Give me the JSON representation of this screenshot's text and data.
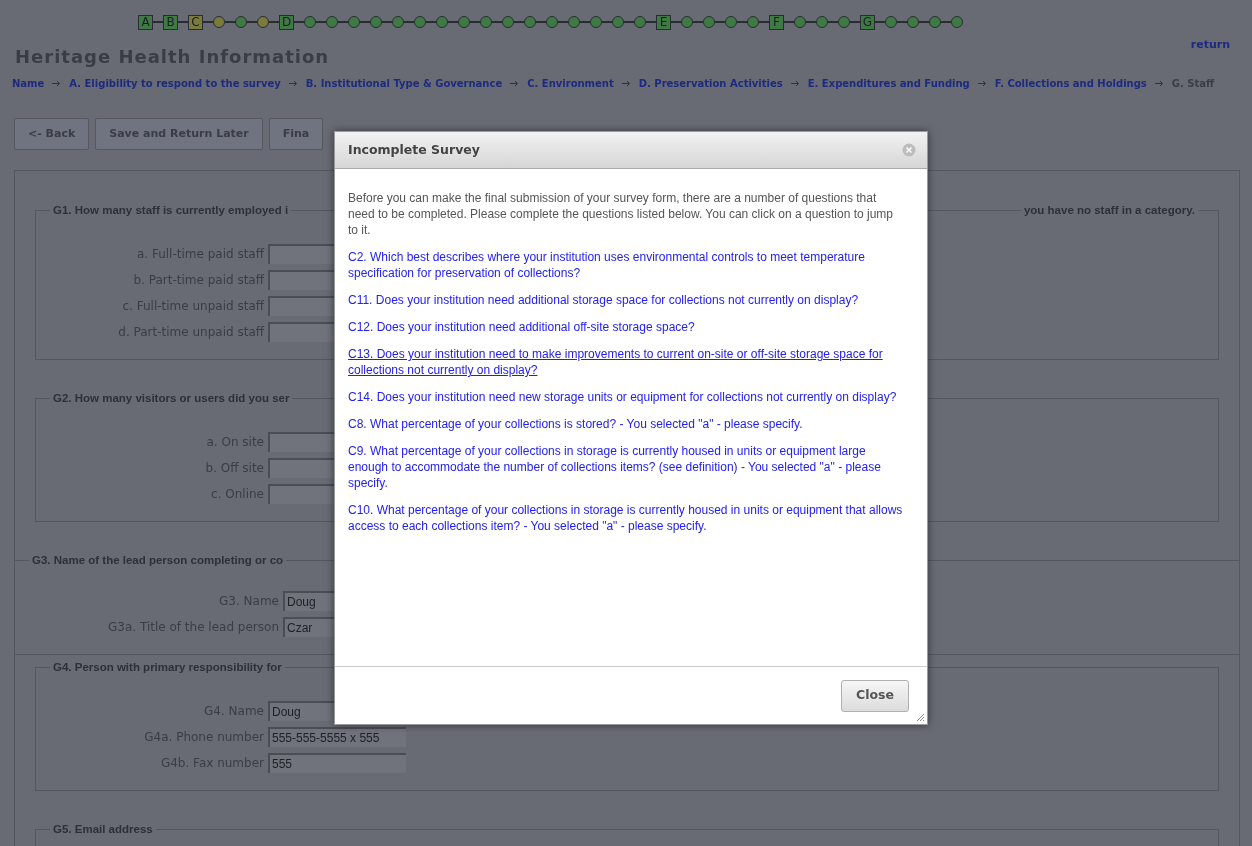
{
  "progress": [
    {
      "label": "A",
      "color": "#3f7a45"
    },
    {
      "label": "B",
      "color": "#3f7a45"
    },
    {
      "label": "C",
      "color": "#7a7a3c"
    },
    {
      "color": "#7a7a3c"
    },
    {
      "color": "#3f7a45"
    },
    {
      "color": "#7a7a3c"
    },
    {
      "label": "D",
      "color": "#3f7a45"
    },
    {
      "color": "#3f7a45"
    },
    {
      "color": "#3f7a45"
    },
    {
      "color": "#3f7a45"
    },
    {
      "color": "#3f7a45"
    },
    {
      "color": "#3f7a45"
    },
    {
      "color": "#3f7a45"
    },
    {
      "color": "#3f7a45"
    },
    {
      "color": "#3f7a45"
    },
    {
      "color": "#3f7a45"
    },
    {
      "color": "#3f7a45"
    },
    {
      "color": "#3f7a45"
    },
    {
      "color": "#3f7a45"
    },
    {
      "color": "#3f7a45"
    },
    {
      "color": "#3f7a45"
    },
    {
      "color": "#3f7a45"
    },
    {
      "color": "#3f7a45"
    },
    {
      "label": "E",
      "color": "#3f7a45"
    },
    {
      "color": "#3f7a45"
    },
    {
      "color": "#3f7a45"
    },
    {
      "color": "#3f7a45"
    },
    {
      "color": "#3f7a45"
    },
    {
      "label": "F",
      "color": "#3f7a45"
    },
    {
      "color": "#3f7a45"
    },
    {
      "color": "#3f7a45"
    },
    {
      "color": "#3f7a45"
    },
    {
      "label": "G",
      "color": "#3f7a45"
    },
    {
      "color": "#3f7a45"
    },
    {
      "color": "#3f7a45"
    },
    {
      "color": "#3f7a45"
    },
    {
      "color": "#3f7a45"
    }
  ],
  "title": "Heritage Health Information",
  "return_link": "return",
  "breadcrumb": [
    {
      "label": "Name",
      "current": false
    },
    {
      "label": "A. Eligibility to respond to the survey",
      "current": false
    },
    {
      "label": "B. Institutional Type & Governance",
      "current": false
    },
    {
      "label": "C. Environment",
      "current": false
    },
    {
      "label": "D. Preservation Activities",
      "current": false
    },
    {
      "label": "E. Expenditures and Funding",
      "current": false
    },
    {
      "label": "F. Collections and Holdings",
      "current": false
    },
    {
      "label": "G. Staff",
      "current": true
    }
  ],
  "buttons": [
    "<- Back",
    "Save and Return Later",
    "Fina"
  ],
  "sections": [
    {
      "kind": "inset",
      "legend": "G1. How many staff is currently employed i",
      "legend_end": "you have no staff in a category.",
      "fields": [
        {
          "label": "a. Full-time paid staff"
        },
        {
          "label": "b. Part-time paid staff"
        },
        {
          "label": "c. Full-time unpaid staff"
        },
        {
          "label": "d. Part-time unpaid staff"
        }
      ]
    },
    {
      "kind": "inset",
      "legend": "G2. How many visitors or users did you ser",
      "fields": [
        {
          "label": "a. On site"
        },
        {
          "label": "b. Off site"
        },
        {
          "label": "c. Online"
        }
      ]
    },
    {
      "kind": "full",
      "legend": "G3. Name of the lead person completing or co",
      "fields": [
        {
          "label": "G3. Name",
          "value": "Doug"
        },
        {
          "label": "G3a. Title of the lead person",
          "value": "Czar"
        }
      ]
    },
    {
      "kind": "inset",
      "legend": "G4. Person with primary responsibility for",
      "fields": [
        {
          "label": "G4. Name",
          "value": "Doug"
        },
        {
          "label": "G4a. Phone number",
          "value": "555-555-5555 x 555"
        },
        {
          "label": "G4b. Fax number",
          "value": "555"
        }
      ]
    },
    {
      "kind": "inset",
      "legend": "G5. Email address"
    }
  ],
  "dialog": {
    "title": "Incomplete Survey",
    "intro": "Before you can make the final submission of your survey form, there are a number of questions that need to be completed. Please complete the questions listed below. You can click on a question to jump to it.",
    "questions": [
      {
        "text": "C2. Which best describes where your institution uses environmental controls to meet temperature specification for preservation of collections?",
        "hovered": false
      },
      {
        "text": "C11. Does your institution need additional storage space for collections not currently on display?",
        "hovered": false
      },
      {
        "text": "C12. Does your institution need additional off-site storage space?",
        "hovered": false
      },
      {
        "text": "C13. Does your institution need to make improvements to current on-site or off-site storage space for collections not currently on display?",
        "hovered": true
      },
      {
        "text": "C14. Does your institution need new storage units or equipment for collections not currently on display?",
        "hovered": false
      },
      {
        "text": "C8. What percentage of your collections is stored? - You selected \"a\" - please specify.",
        "hovered": false
      },
      {
        "text": "C9. What percentage of your collections in storage is currently housed in units or equipment large enough to accommodate the number of collections items? (see definition) - You selected \"a\" - please specify.",
        "hovered": false
      },
      {
        "text": "C10. What percentage of your collections in storage is currently housed in units or equipment that allows access to each collections item? - You selected \"a\" - please specify.",
        "hovered": false
      }
    ],
    "close_button": "Close"
  }
}
